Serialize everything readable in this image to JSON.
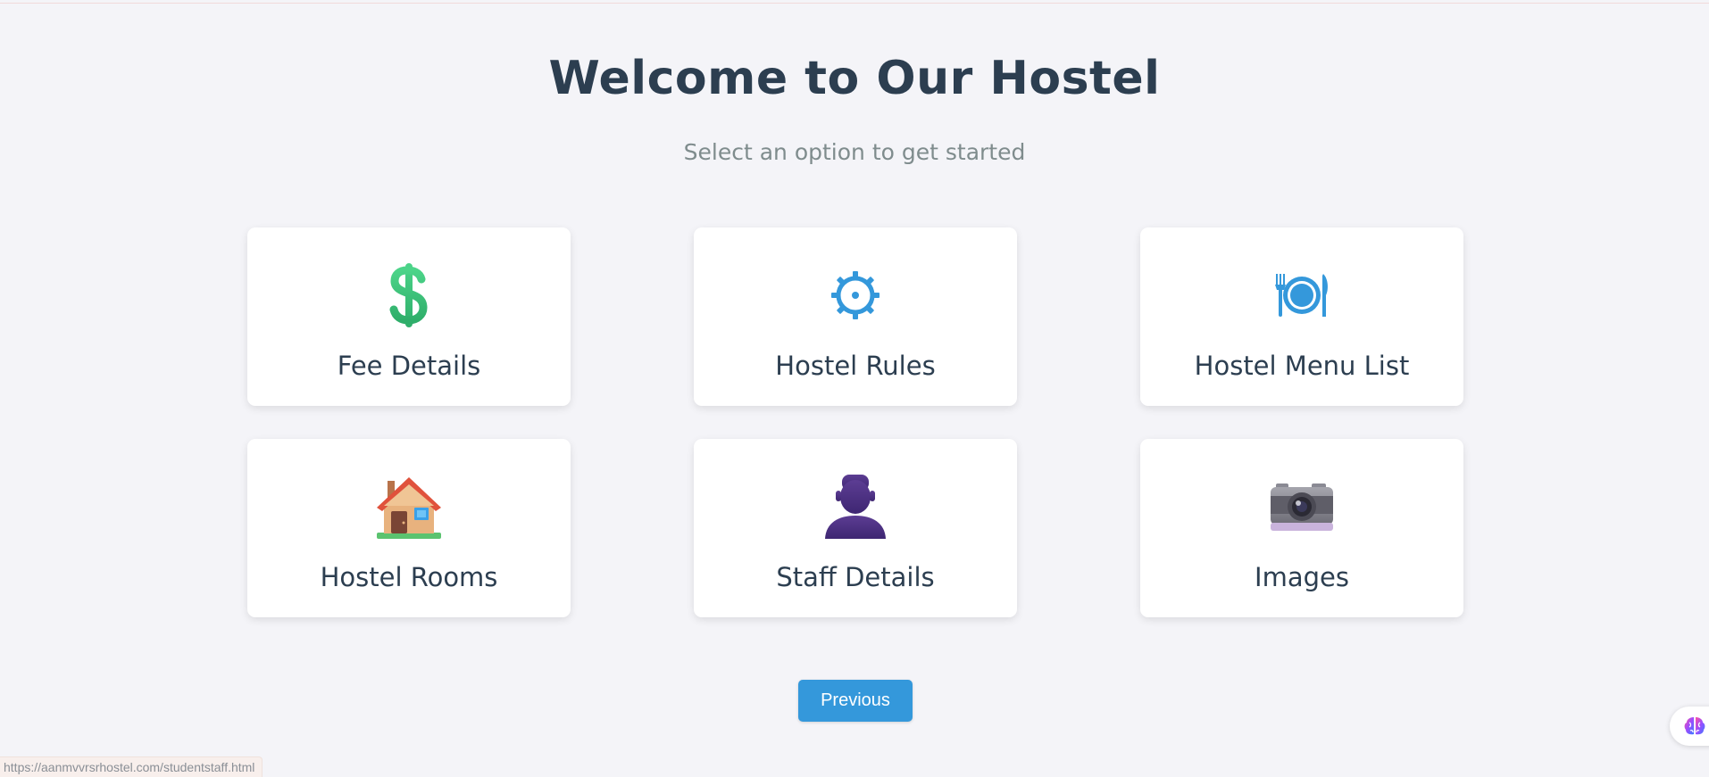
{
  "header": {
    "title": "Welcome to Our Hostel",
    "subtitle": "Select an option to get started"
  },
  "cards": [
    {
      "label": "Fee Details",
      "icon": "dollar-sign-icon"
    },
    {
      "label": "Hostel Rules",
      "icon": "gear-icon"
    },
    {
      "label": "Hostel Menu List",
      "icon": "plate-cutlery-icon"
    },
    {
      "label": "Hostel Rooms",
      "icon": "house-icon"
    },
    {
      "label": "Staff Details",
      "icon": "person-silhouette-icon"
    },
    {
      "label": "Images",
      "icon": "camera-icon"
    }
  ],
  "nav": {
    "previous_label": "Previous"
  },
  "status_bar": {
    "url": "https://aanmvvrsrhostel.com/studentstaff.html"
  },
  "floating_widget": {
    "icon": "brain-icon"
  },
  "colors": {
    "background": "#f4f4f8",
    "title": "#2c3e50",
    "subtitle": "#7f8c8d",
    "accent": "#3498db",
    "dollar_green": "#3cc47c"
  }
}
